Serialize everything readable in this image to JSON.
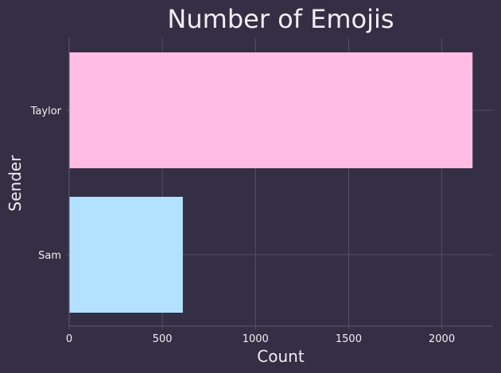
{
  "chart_data": {
    "type": "bar",
    "orientation": "horizontal",
    "title": "Number of Emojis",
    "xlabel": "Count",
    "ylabel": "Sender",
    "categories": [
      "Taylor",
      "Sam"
    ],
    "values": [
      2165,
      610
    ],
    "bar_colors": [
      "#ffbde4",
      "#b2e2ff"
    ],
    "xlim": [
      0,
      2275
    ],
    "xticks": [
      0,
      500,
      1000,
      1500,
      2000
    ],
    "grid": true,
    "legend": "none"
  },
  "colors": {
    "background": "#342f44",
    "text": "#f0eef5",
    "grid": "#5e586f",
    "axis": "#5e586f"
  }
}
